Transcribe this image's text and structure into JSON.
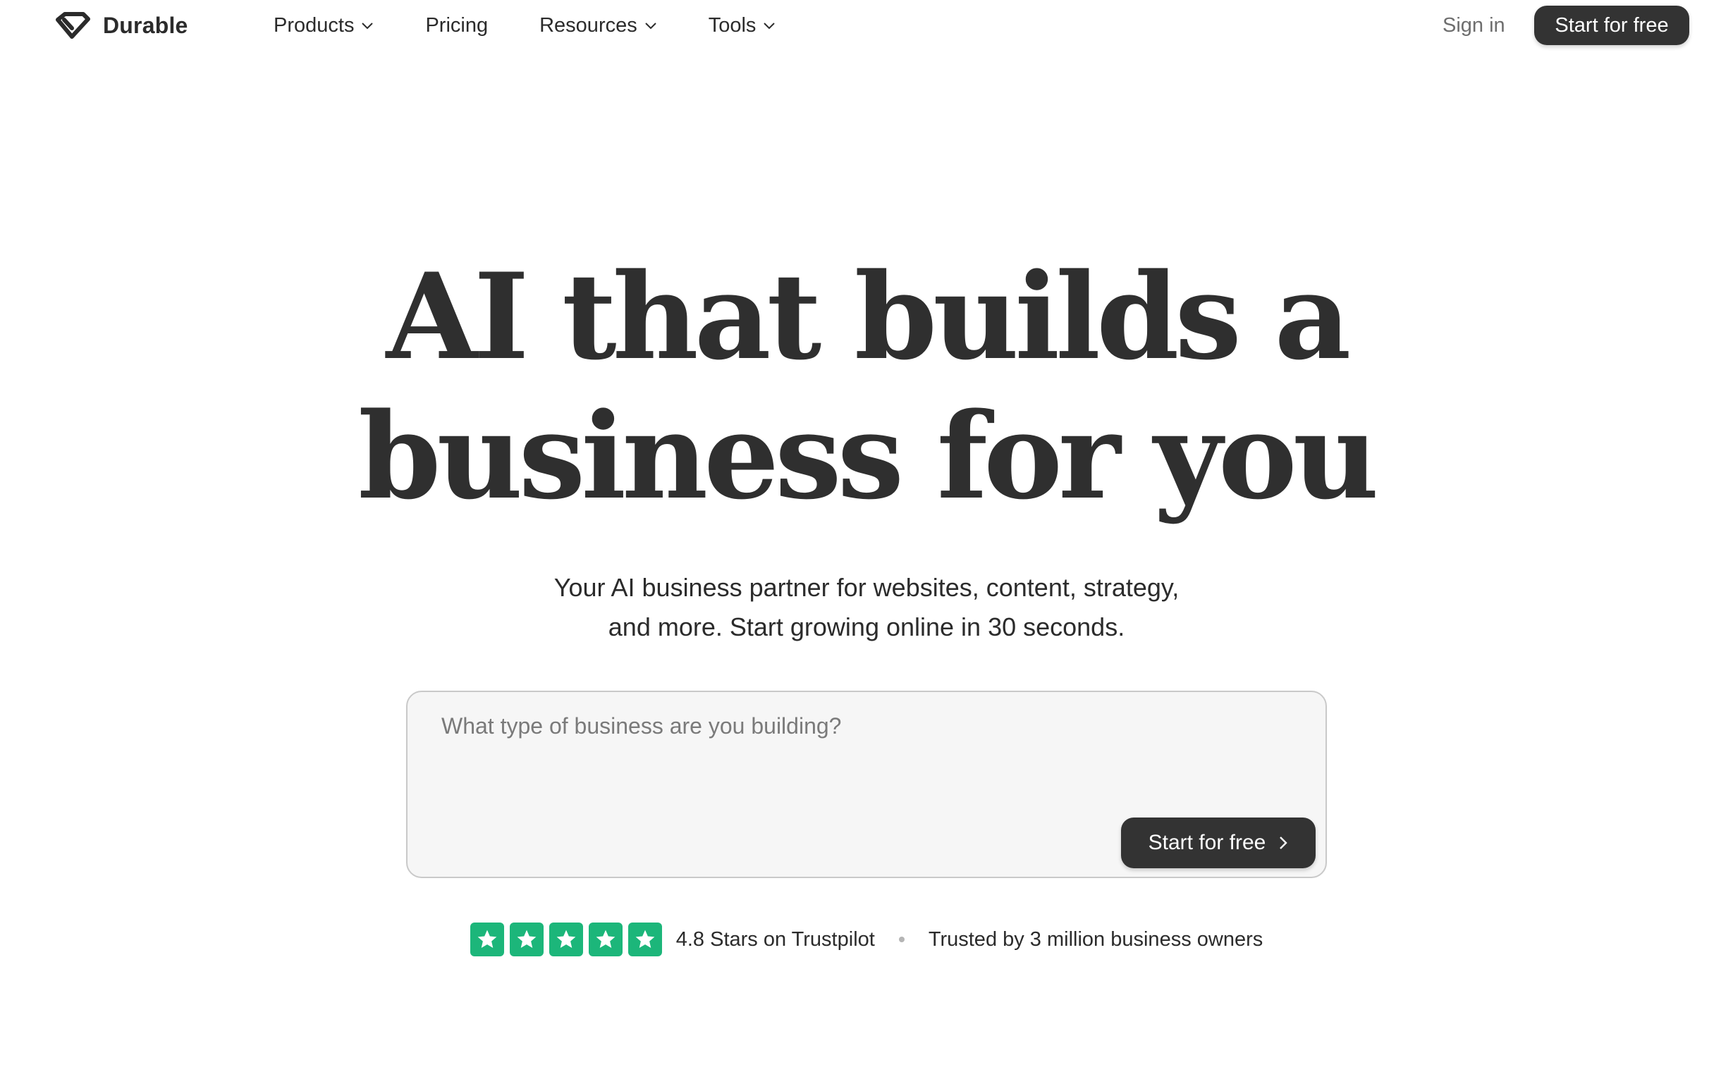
{
  "nav": {
    "brand": "Durable",
    "links": [
      {
        "label": "Products",
        "dropdown": true
      },
      {
        "label": "Pricing",
        "dropdown": false
      },
      {
        "label": "Resources",
        "dropdown": true
      },
      {
        "label": "Tools",
        "dropdown": true
      }
    ],
    "sign_in": "Sign in",
    "cta": "Start for free"
  },
  "hero": {
    "title_line1": "AI that builds a",
    "title_line2": "business for you",
    "subtitle_line1": "Your AI business partner for websites, content, strategy,",
    "subtitle_line2": "and more. Start growing online in 30 seconds."
  },
  "prompt": {
    "placeholder": "What type of business are you building?",
    "value": "",
    "cta": "Start for free"
  },
  "trust": {
    "stars_count": 5,
    "rating_text": "4.8 Stars on Trustpilot",
    "trusted_text": "Trusted by 3 million business owners"
  },
  "colors": {
    "dark": "#333333",
    "trustpilot_green": "#1cb67a",
    "muted": "#6e6e6e"
  },
  "icons": {
    "logo": "diamond-logo-icon",
    "dropdown": "chevron-down-icon",
    "cta_arrow": "chevron-right-icon",
    "star": "star-icon"
  }
}
